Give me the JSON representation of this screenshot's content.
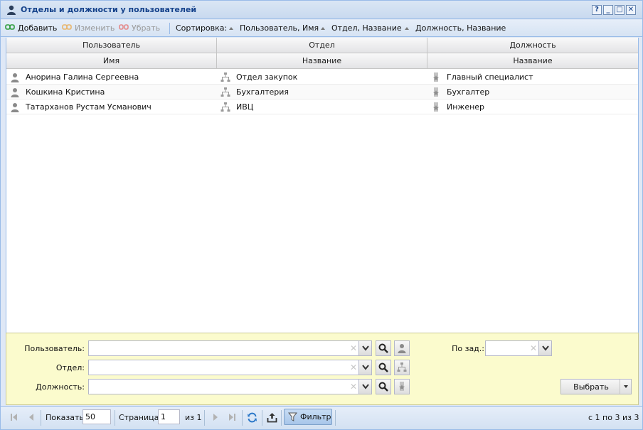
{
  "window": {
    "title": "Отделы и должности у пользователей",
    "tools": [
      "?",
      "_",
      "□",
      "✕"
    ]
  },
  "toolbar": {
    "add_label": "Добавить",
    "edit_label": "Изменить",
    "remove_label": "Убрать",
    "sort_label": "Сортировка:",
    "sort_items": [
      "Пользователь, Имя",
      "Отдел, Название",
      "Должность, Название"
    ]
  },
  "grid": {
    "group_headers": [
      "Пользователь",
      "Отдел",
      "Должность"
    ],
    "column_headers": [
      "Имя",
      "Название",
      "Название"
    ],
    "rows": [
      {
        "user": "Анорина Галина Сергеевна",
        "department": "Отдел закупок",
        "position": "Главный специалист"
      },
      {
        "user": "Кошкина Кристина",
        "department": "Бухгалтерия",
        "position": "Бухгалтер"
      },
      {
        "user": "Татарханов Рустам Усманович",
        "department": "ИВЦ",
        "position": "Инженер"
      }
    ]
  },
  "filter": {
    "user_label": "Пользователь:",
    "department_label": "Отдел:",
    "position_label": "Должность:",
    "by_task_label": "По зад.:",
    "select_label": "Выбрать"
  },
  "pager": {
    "show_label": "Показать",
    "page_size": "50",
    "page_label": "Страница",
    "page_value": "1",
    "of_label": "из 1",
    "filter_label": "Фильтр",
    "summary": "с 1 по 3 из 3"
  },
  "colors": {
    "title_text": "#15428b",
    "border": "#99bbe8",
    "filter_bg": "#fbfbcd"
  }
}
